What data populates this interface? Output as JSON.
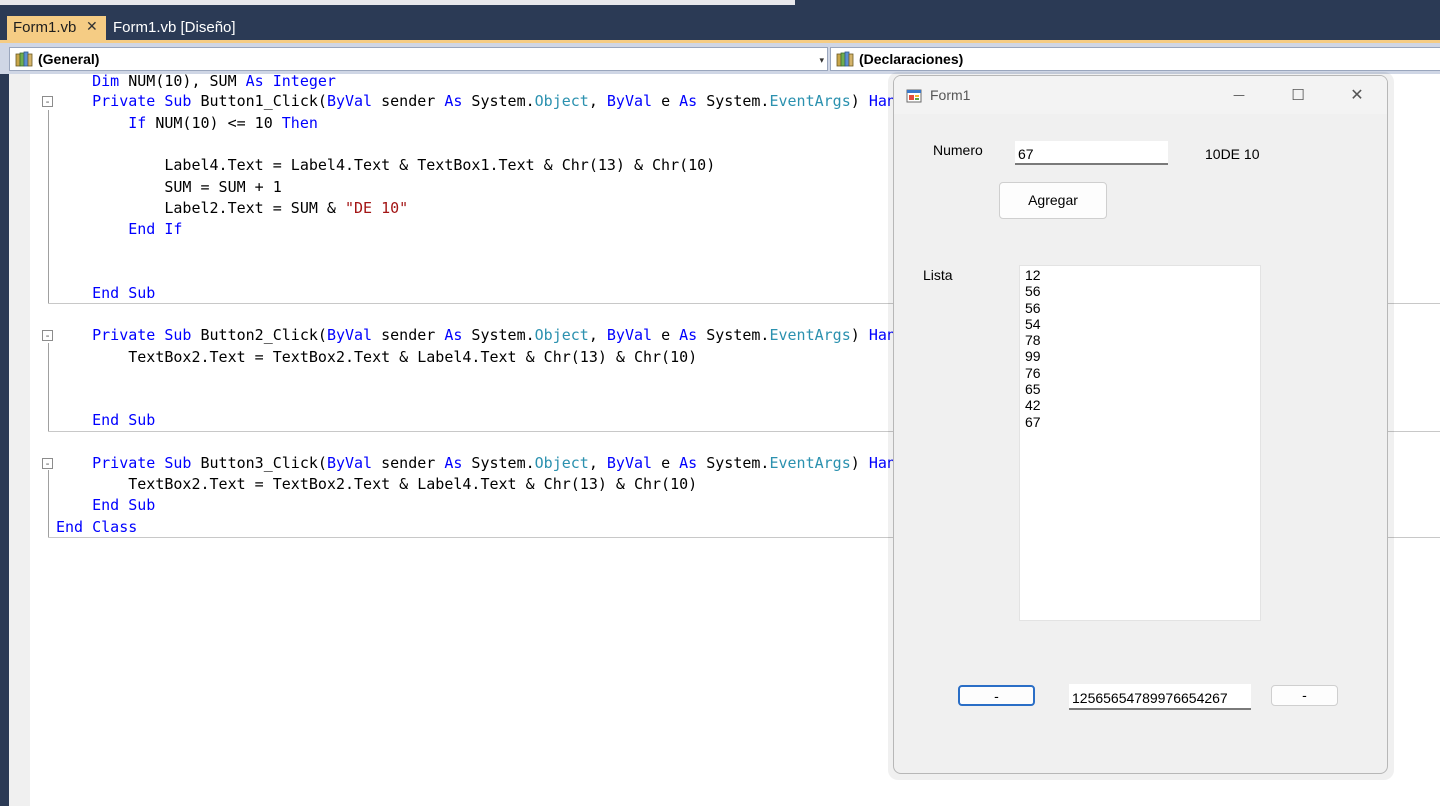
{
  "tabs": {
    "active": "Form1.vb",
    "inactive": "Form1.vb [Diseño]",
    "close_glyph": "✕"
  },
  "dropdowns": {
    "left": "(General)",
    "right": "(Declaraciones)",
    "arrow": "▾"
  },
  "code": {
    "fold_glyph": "⊟",
    "line1": [
      {
        "t": "    ",
        "c": ""
      },
      {
        "t": "Dim",
        "c": "kw"
      },
      {
        "t": " NUM(10), SUM ",
        "c": ""
      },
      {
        "t": "As",
        "c": "kw"
      },
      {
        "t": " ",
        "c": ""
      },
      {
        "t": "Integer",
        "c": "kw"
      }
    ],
    "line2": [
      {
        "t": "    ",
        "c": ""
      },
      {
        "t": "Private",
        "c": "kw"
      },
      {
        "t": " ",
        "c": ""
      },
      {
        "t": "Sub",
        "c": "kw"
      },
      {
        "t": " Button1_Click(",
        "c": ""
      },
      {
        "t": "ByVal",
        "c": "kw"
      },
      {
        "t": " sender ",
        "c": ""
      },
      {
        "t": "As",
        "c": "kw"
      },
      {
        "t": " System.",
        "c": ""
      },
      {
        "t": "Object",
        "c": "ty"
      },
      {
        "t": ", ",
        "c": ""
      },
      {
        "t": "ByVal",
        "c": "kw"
      },
      {
        "t": " e ",
        "c": ""
      },
      {
        "t": "As",
        "c": "kw"
      },
      {
        "t": " System.",
        "c": ""
      },
      {
        "t": "EventArgs",
        "c": "ty"
      },
      {
        "t": ") ",
        "c": ""
      },
      {
        "t": "Han",
        "c": "kw"
      }
    ],
    "line3": [
      {
        "t": "        ",
        "c": ""
      },
      {
        "t": "If",
        "c": "kw"
      },
      {
        "t": " NUM(10) <= 10 ",
        "c": ""
      },
      {
        "t": "Then",
        "c": "kw"
      }
    ],
    "line4": [
      {
        "t": "            Label4.Text = Label4.Text & TextBox1.Text & Chr(13) & Chr(10)",
        "c": ""
      }
    ],
    "line5": [
      {
        "t": "            SUM = SUM + 1",
        "c": ""
      }
    ],
    "line6": [
      {
        "t": "            Label2.Text = SUM & ",
        "c": ""
      },
      {
        "t": "\"DE 10\"",
        "c": "st"
      }
    ],
    "line7": [
      {
        "t": "        ",
        "c": ""
      },
      {
        "t": "End",
        "c": "kw"
      },
      {
        "t": " ",
        "c": ""
      },
      {
        "t": "If",
        "c": "kw"
      }
    ],
    "line8": [
      {
        "t": "    ",
        "c": ""
      },
      {
        "t": "End",
        "c": "kw"
      },
      {
        "t": " ",
        "c": ""
      },
      {
        "t": "Sub",
        "c": "kw"
      }
    ],
    "line9": [
      {
        "t": "    ",
        "c": ""
      },
      {
        "t": "Private",
        "c": "kw"
      },
      {
        "t": " ",
        "c": ""
      },
      {
        "t": "Sub",
        "c": "kw"
      },
      {
        "t": " Button2_Click(",
        "c": ""
      },
      {
        "t": "ByVal",
        "c": "kw"
      },
      {
        "t": " sender ",
        "c": ""
      },
      {
        "t": "As",
        "c": "kw"
      },
      {
        "t": " System.",
        "c": ""
      },
      {
        "t": "Object",
        "c": "ty"
      },
      {
        "t": ", ",
        "c": ""
      },
      {
        "t": "ByVal",
        "c": "kw"
      },
      {
        "t": " e ",
        "c": ""
      },
      {
        "t": "As",
        "c": "kw"
      },
      {
        "t": " System.",
        "c": ""
      },
      {
        "t": "EventArgs",
        "c": "ty"
      },
      {
        "t": ") ",
        "c": ""
      },
      {
        "t": "Han",
        "c": "kw"
      }
    ],
    "line10": [
      {
        "t": "        TextBox2.Text = TextBox2.Text & Label4.Text & Chr(13) & Chr(10)",
        "c": ""
      }
    ],
    "line11": [
      {
        "t": "    ",
        "c": ""
      },
      {
        "t": "End",
        "c": "kw"
      },
      {
        "t": " ",
        "c": ""
      },
      {
        "t": "Sub",
        "c": "kw"
      }
    ],
    "line12": [
      {
        "t": "    ",
        "c": ""
      },
      {
        "t": "Private",
        "c": "kw"
      },
      {
        "t": " ",
        "c": ""
      },
      {
        "t": "Sub",
        "c": "kw"
      },
      {
        "t": " Button3_Click(",
        "c": ""
      },
      {
        "t": "ByVal",
        "c": "kw"
      },
      {
        "t": " sender ",
        "c": ""
      },
      {
        "t": "As",
        "c": "kw"
      },
      {
        "t": " System.",
        "c": ""
      },
      {
        "t": "Object",
        "c": "ty"
      },
      {
        "t": ", ",
        "c": ""
      },
      {
        "t": "ByVal",
        "c": "kw"
      },
      {
        "t": " e ",
        "c": ""
      },
      {
        "t": "As",
        "c": "kw"
      },
      {
        "t": " System.",
        "c": ""
      },
      {
        "t": "EventArgs",
        "c": "ty"
      },
      {
        "t": ") ",
        "c": ""
      },
      {
        "t": "Han",
        "c": "kw"
      }
    ],
    "line13": [
      {
        "t": "        TextBox2.Text = TextBox2.Text & Label4.Text & Chr(13) & Chr(10)",
        "c": ""
      }
    ],
    "line14": [
      {
        "t": "    ",
        "c": ""
      },
      {
        "t": "End",
        "c": "kw"
      },
      {
        "t": " ",
        "c": ""
      },
      {
        "t": "Sub",
        "c": "kw"
      }
    ],
    "line15": [
      {
        "t": "End",
        "c": "kw"
      },
      {
        "t": " ",
        "c": ""
      },
      {
        "t": "Class",
        "c": "kw"
      }
    ]
  },
  "form": {
    "title": "Form1",
    "minimize_glyph": "—",
    "maximize_glyph": "☐",
    "close_glyph": "✕",
    "numero_label": "Numero",
    "numero_value": "67",
    "count_label": "10DE 10",
    "agregar_button": "Agregar",
    "lista_label": "Lista",
    "list_items": [
      "12",
      "56",
      "56",
      "54",
      "78",
      "99",
      "76",
      "65",
      "42",
      "67"
    ],
    "button2_label": "-",
    "textbox2_value": "12565654789976654267",
    "button3_label": "-"
  },
  "colors": {
    "ide_frame": "#2b3a55",
    "active_tab": "#f5cc84",
    "keyword": "#0000ff",
    "type": "#2b91af",
    "string": "#a31515"
  }
}
